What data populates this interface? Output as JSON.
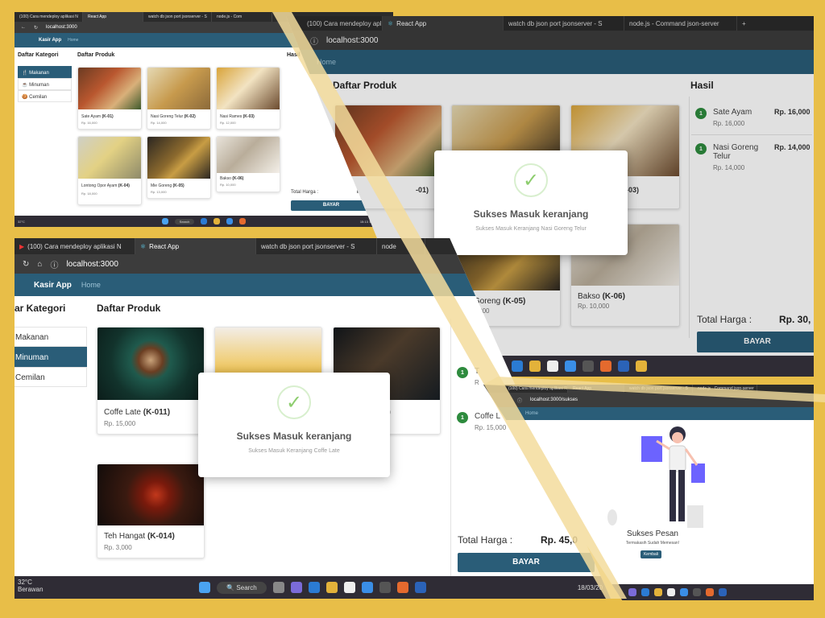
{
  "app": {
    "brand": "Kasir App",
    "home": "Home",
    "url": "localhost:3000",
    "url_success": "localhost:3000/sukses"
  },
  "tabs": [
    "(100) Cara mendeploy aplikasi Re",
    "React App",
    "watch db json port jsonserver - S",
    "node.js - Command json-server"
  ],
  "tabs_short": [
    "(100) Cara mendeploy aplikasi N",
    "React App",
    "watch db json port jsonserver - S",
    "node.js - Com"
  ],
  "tabs_mid": [
    "(100) Cara mendeploy aplikasi N",
    "React App",
    "watch db json port jsonserver - S",
    "node"
  ],
  "headings": {
    "kategori": "Daftar Kategori",
    "produk": "Daftar Produk",
    "hasil": "Hasil",
    "kategori_cut": "ar Kategori"
  },
  "kategori": [
    "Makanan",
    "Minuman",
    "Cemilan"
  ],
  "makanan": [
    {
      "name": "Sate Ayam",
      "code": "(K-01)",
      "price": "Rp. 16,000"
    },
    {
      "name": "Nasi Goreng Telur",
      "code": "(K-02)",
      "price": "Rp. 14,000"
    },
    {
      "name": "Nasi Rames",
      "code": "(K-03)",
      "price": "Rp. 12,000"
    },
    {
      "name": "Lontong Opor Ayam",
      "code": "(K-04)",
      "price": "Rp. 18,000"
    },
    {
      "name": "Mie Goreng",
      "code": "(K-05)",
      "price": "Rp. 13,000"
    },
    {
      "name": "Bakso",
      "code": "(K-06)",
      "price": "Rp. 10,000"
    }
  ],
  "minuman": [
    {
      "name": "Coffe Late",
      "code": "(K-011)",
      "price": "Rp. 15,000"
    },
    {
      "name": "Teh Hangat",
      "code": "(K-014)",
      "price": "Rp. 3,000"
    }
  ],
  "cart": [
    {
      "qty": "1",
      "name": "Sate Ayam",
      "price": "Rp. 16,000",
      "total": "Rp. 16,000"
    },
    {
      "qty": "1",
      "name": "Nasi Goreng Telur",
      "price": "Rp. 14,000",
      "total": "Rp. 14,000"
    }
  ],
  "cart_cut": [
    {
      "qty": "1",
      "name": "Coffe L",
      "price": "Rp. 15,000"
    }
  ],
  "total_label": "Total Harga :",
  "total_zero": "Rp. 0",
  "total_tr": "Rp. 30,",
  "total_bl": "Rp. 45,0",
  "bayar": "BAYAR",
  "modal": {
    "title": "Sukses Masuk keranjang",
    "sub1": "Sukses Masuk Keranjang Nasi Goreng Telur",
    "sub2": "Sukses Masuk Keranjang Coffe Late"
  },
  "tr_cut": {
    "k01": "-01)",
    "k03": "-03)",
    "k05": "Mie Goreng",
    "k05code": "(K-05)",
    "k05price": "13,000",
    "k06": "Bakso",
    "k06code": "(K-06)",
    "k06price": "Rp. 10,000",
    "mid": "0)",
    "cut_t": "T",
    "cut_r": "R"
  },
  "sukses": {
    "title": "Sukses Pesan",
    "sub": "Termakasih Sudah Memesan!",
    "btn": "Kembali"
  },
  "weather": {
    "temp": "32°C",
    "desc": "Berawan"
  },
  "clock": {
    "time": "15:13",
    "date": "18/03/2023",
    "date_cut": "18/03/20"
  },
  "search": "Search"
}
